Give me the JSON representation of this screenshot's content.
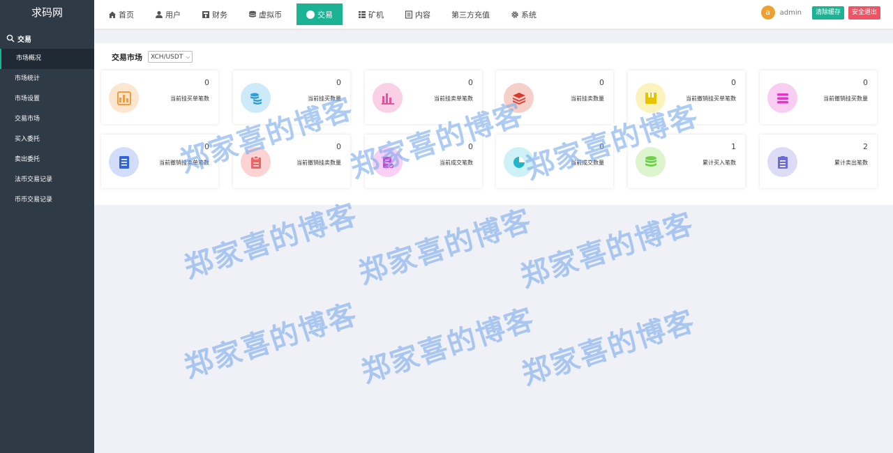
{
  "sidebar": {
    "brand": "求码网",
    "group": "交易",
    "items": [
      {
        "label": "市场概况"
      },
      {
        "label": "市场统计"
      },
      {
        "label": "市场设置"
      },
      {
        "label": "交易市场"
      },
      {
        "label": "买入委托"
      },
      {
        "label": "卖出委托"
      },
      {
        "label": "法币交易记录"
      },
      {
        "label": "币币交易记录"
      }
    ]
  },
  "topnav": {
    "items": [
      {
        "label": "首页",
        "icon": "home-icon"
      },
      {
        "label": "用户",
        "icon": "user-icon"
      },
      {
        "label": "财务",
        "icon": "finance-icon"
      },
      {
        "label": "虚拟币",
        "icon": "coin-stack-icon"
      },
      {
        "label": "交易",
        "icon": "trade-icon"
      },
      {
        "label": "矿机",
        "icon": "grid-icon"
      },
      {
        "label": "内容",
        "icon": "document-icon"
      },
      {
        "label": "第三方充值",
        "icon": ""
      },
      {
        "label": "系统",
        "icon": "gear-icon"
      }
    ],
    "avatar_letter": "a",
    "username": "admin",
    "clear_cache_label": "清除缓存",
    "logout_label": "安全退出"
  },
  "market": {
    "title": "交易市场",
    "selected_pair": "XCH/USDT"
  },
  "stats": [
    {
      "value": "0",
      "label": "当前挂买单笔数",
      "icon": "bar-chart-icon",
      "color": "#f49b3b",
      "bg": "#fde6cf"
    },
    {
      "value": "0",
      "label": "当前挂买数量",
      "icon": "coins-icon",
      "color": "#2d9cdb",
      "bg": "#cdeaf8"
    },
    {
      "value": "0",
      "label": "当前挂卖单笔数",
      "icon": "column-chart-icon",
      "color": "#e0559b",
      "bg": "#f9d0e5"
    },
    {
      "value": "0",
      "label": "当前挂卖数量",
      "icon": "layers-icon",
      "color": "#d7392f",
      "bg": "#f7cfc9"
    },
    {
      "value": "0",
      "label": "当前撤销挂买单笔数",
      "icon": "save-icon",
      "color": "#e8c300",
      "bg": "#fbf3bd"
    },
    {
      "value": "0",
      "label": "当前撤销挂买数量",
      "icon": "menu-icon",
      "color": "#e236c9",
      "bg": "#f9cdf1"
    },
    {
      "value": "0",
      "label": "当前撤销挂卖单笔数",
      "icon": "document-icon",
      "color": "#2f63e0",
      "bg": "#d1ddf9"
    },
    {
      "value": "0",
      "label": "当前撤销挂卖数量",
      "icon": "clipboard-icon",
      "color": "#ec6464",
      "bg": "#fbd3d3"
    },
    {
      "value": "0",
      "label": "当前成交笔数",
      "icon": "checklist-icon",
      "color": "#d63cd2",
      "bg": "#f8cff5"
    },
    {
      "value": "0",
      "label": "当前成交数量",
      "icon": "pie-chart-icon",
      "color": "#22b4c9",
      "bg": "#cdf1f6"
    },
    {
      "value": "1",
      "label": "累计买入笔数",
      "icon": "database-icon",
      "color": "#6fd14a",
      "bg": "#dcf5cf"
    },
    {
      "value": "2",
      "label": "累计卖出笔数",
      "icon": "list-icon",
      "color": "#6a6ad8",
      "bg": "#dcdcf7"
    }
  ],
  "watermark": "郑家喜的博客"
}
